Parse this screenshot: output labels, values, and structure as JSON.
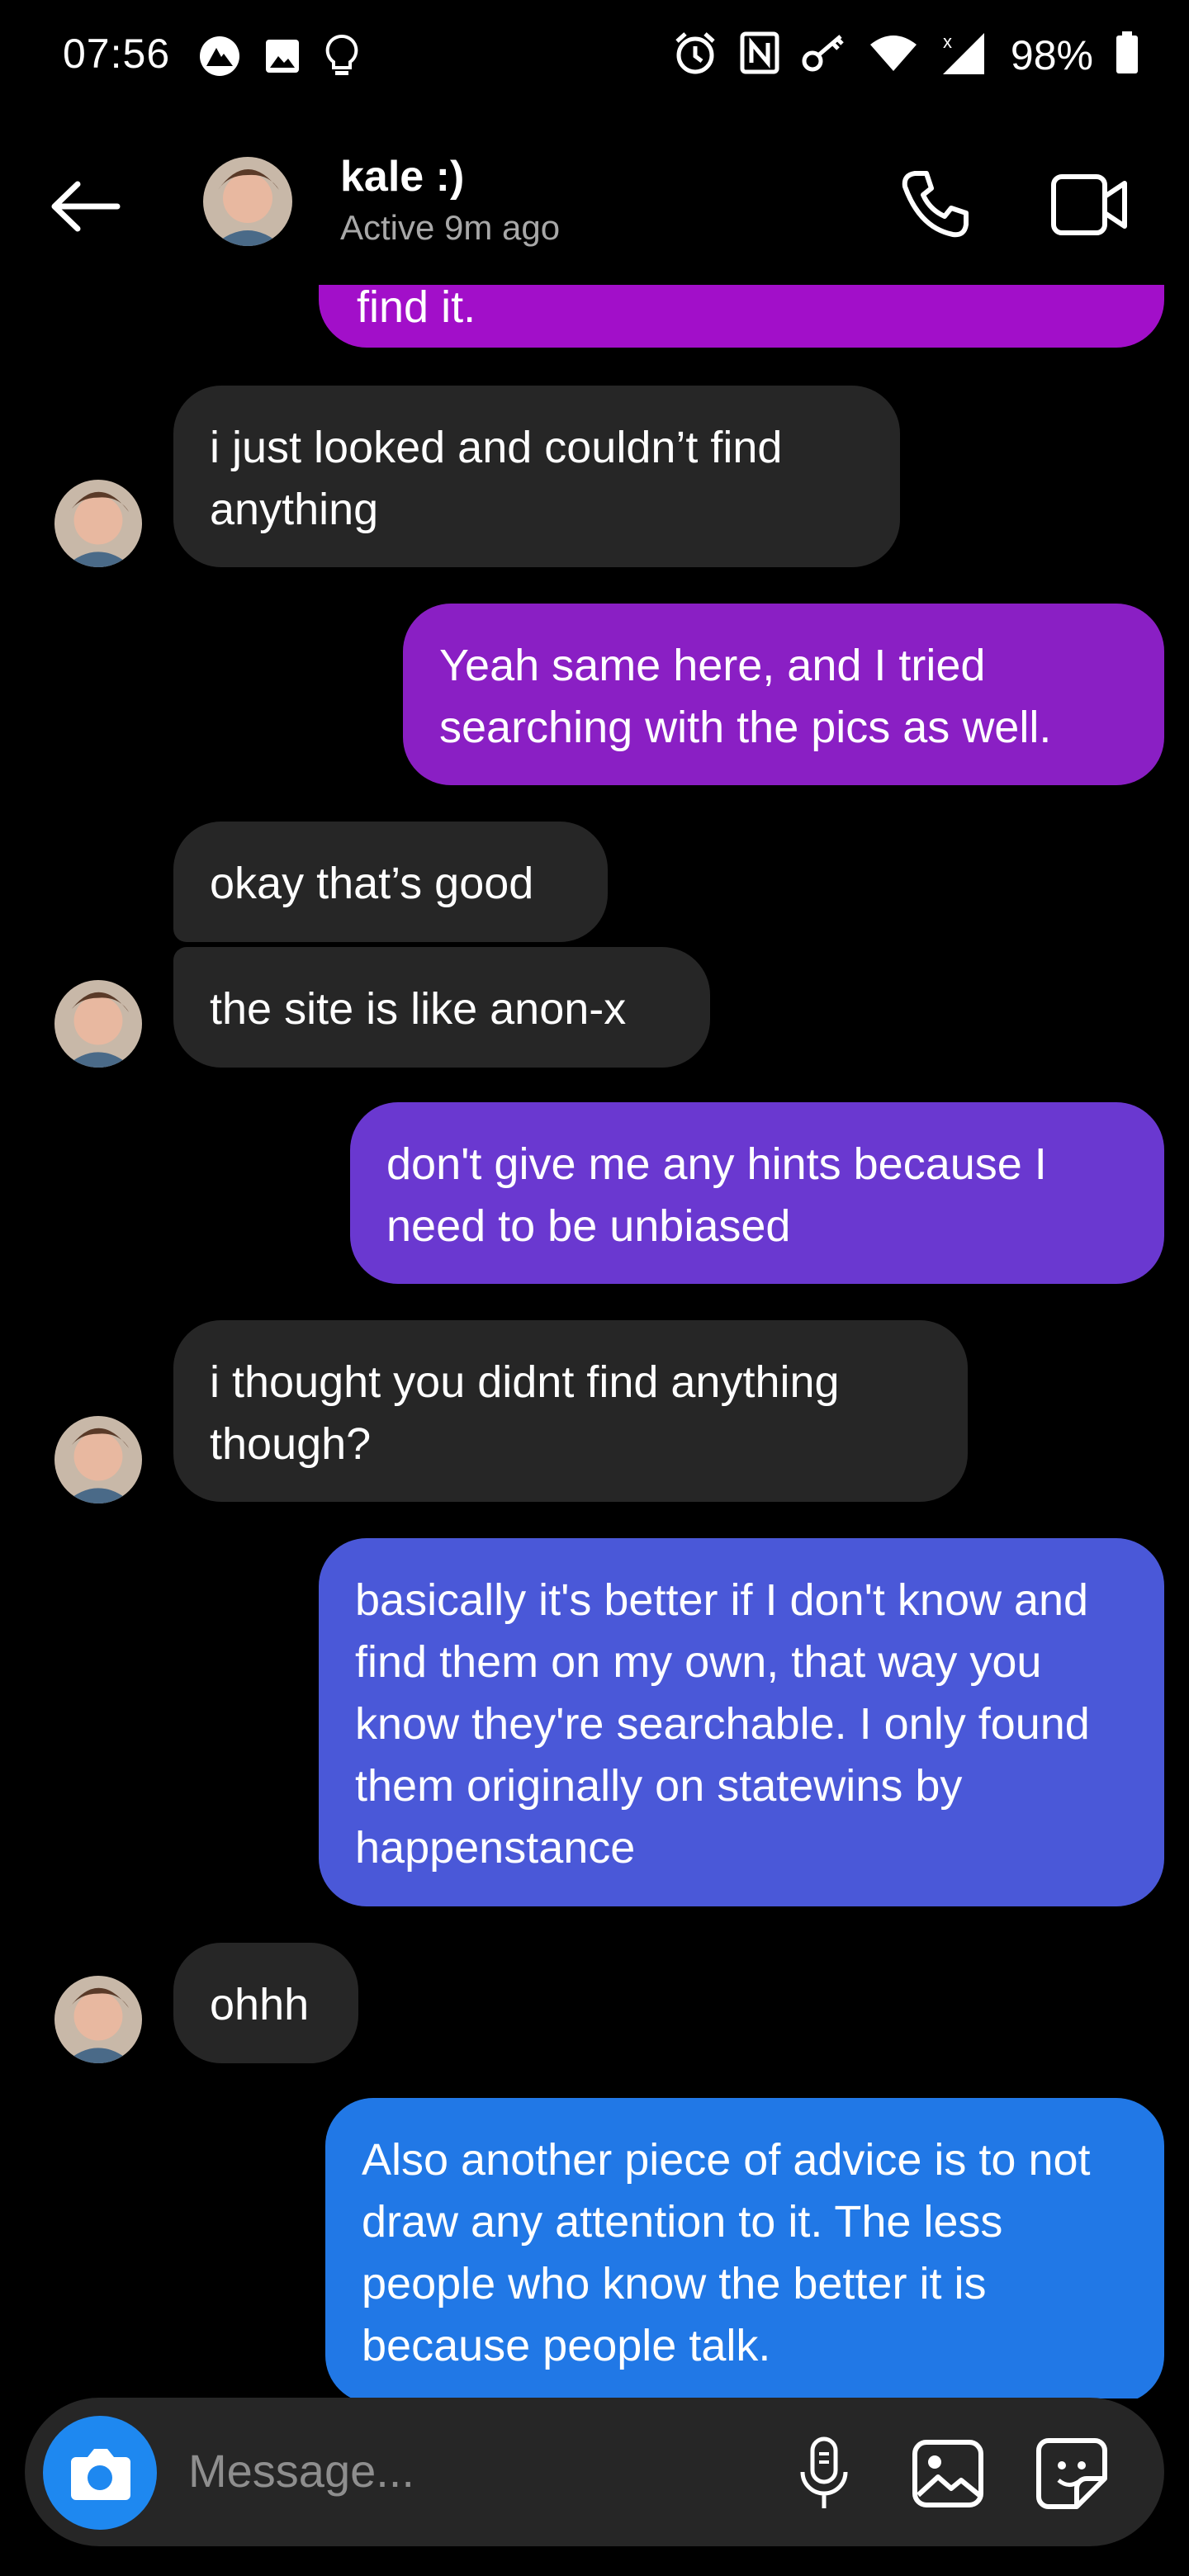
{
  "status_bar": {
    "time": "07:56",
    "battery": "98%",
    "left_icons": [
      "nordvpn-icon",
      "image-icon",
      "bulb-icon"
    ],
    "right_icons": [
      "alarm-icon",
      "nfc-icon",
      "key-icon",
      "wifi-icon",
      "signal-icon",
      "battery-icon"
    ]
  },
  "header": {
    "name": "kale :)",
    "status": "Active 9m ago",
    "icons": [
      "back-arrow-icon",
      "avatar",
      "phone-icon",
      "video-icon"
    ]
  },
  "messages": [
    {
      "from": "me",
      "text": "find it.",
      "color": "#a20fc9"
    },
    {
      "from": "them",
      "text": "i just looked and couldn’t find anything"
    },
    {
      "from": "me",
      "text": "Yeah same here, and I tried searching with the pics as well.",
      "color": "#8a1fc4"
    },
    {
      "from": "them",
      "text": "okay that’s good"
    },
    {
      "from": "them",
      "text": "the site is like anon-x"
    },
    {
      "from": "me",
      "text": "don't give me any hints because I need to be unbiased",
      "color": "#6a38d0"
    },
    {
      "from": "them",
      "text": "i thought you didnt find anything though?"
    },
    {
      "from": "me",
      "text": "basically it's better if I don't know and find them on my own, that way you know they're searchable. I only found them originally on statewins by happenstance",
      "color": "#4a58d8"
    },
    {
      "from": "them",
      "text": "ohhh"
    },
    {
      "from": "me",
      "text": "Also another piece of advice is to not draw any attention to it. The less people who know the better it is because people talk.",
      "color": "#2178e6"
    }
  ],
  "composer": {
    "placeholder": "Message...",
    "icons": [
      "camera-icon",
      "microphone-icon",
      "gallery-icon",
      "sticker-icon"
    ],
    "camera_color": "#1e88f0"
  }
}
